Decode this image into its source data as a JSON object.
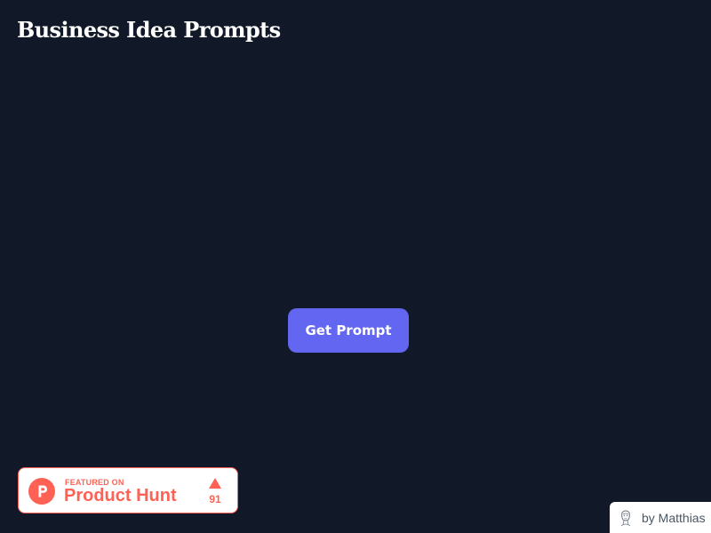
{
  "page": {
    "title": "Business Idea Prompts",
    "background_color": "#111827"
  },
  "main": {
    "get_prompt_label": "Get Prompt",
    "button_color": "#6366f1"
  },
  "product_hunt_badge": {
    "featured_label": "FEATURED ON",
    "name": "Product Hunt",
    "upvotes": "91",
    "accent_color": "#ff6154",
    "logo_letter": "P"
  },
  "credit": {
    "label": "by Matthias",
    "avatar_icon": "sketch-portrait-icon"
  }
}
